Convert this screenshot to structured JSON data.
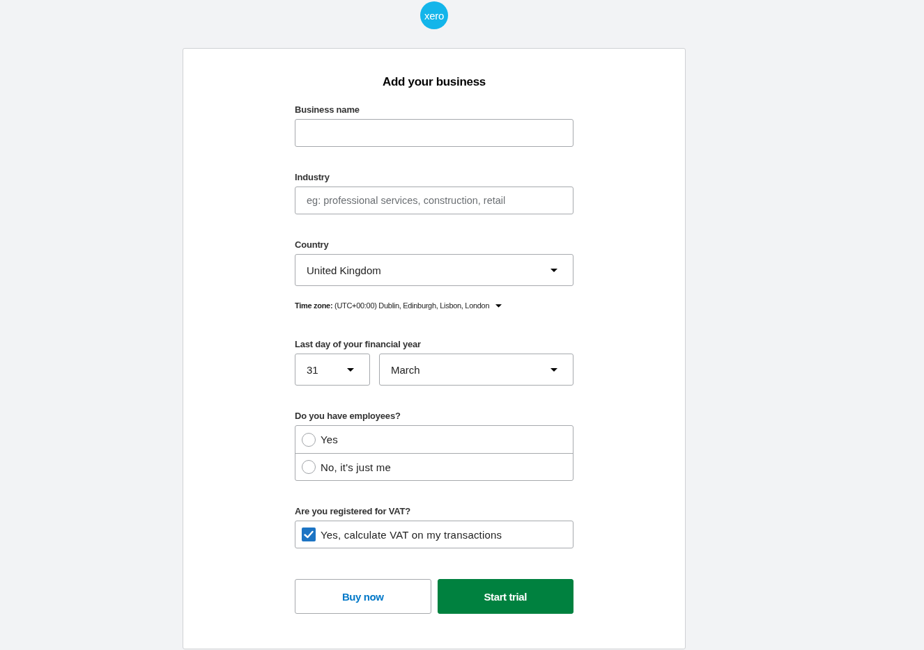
{
  "logo": {
    "text": "xero"
  },
  "title": "Add your business",
  "fields": [
    {
      "kind": "text",
      "label": "Business name"
    },
    {
      "kind": "text",
      "label": "Industry",
      "placeholder": "eg: professional services, construction, retail"
    },
    {
      "kind": "select",
      "label": "Country",
      "value": "United Kingdom"
    },
    {
      "kind": "note",
      "text": "**Time zone:** (UTC+00:00) Dublin, Edinburgh, Lisbon, London"
    },
    {
      "kind": "date",
      "label": "Last day of your financial year",
      "day": "31",
      "month": "March"
    },
    {
      "kind": "radio",
      "label": "Do you have employees?",
      "options": [
        {
          "label": "Yes",
          "selected": false
        },
        {
          "label": "No, it's just me",
          "selected": false
        }
      ]
    },
    {
      "kind": "checkbox",
      "label": "Are you registered for VAT?",
      "options": [
        {
          "label": "Yes, calculate VAT on my transactions",
          "checked": true
        }
      ]
    }
  ],
  "buttons": [
    {
      "label": "Buy now",
      "kind": "secondary"
    },
    {
      "label": "Start trial",
      "kind": "primary"
    }
  ]
}
